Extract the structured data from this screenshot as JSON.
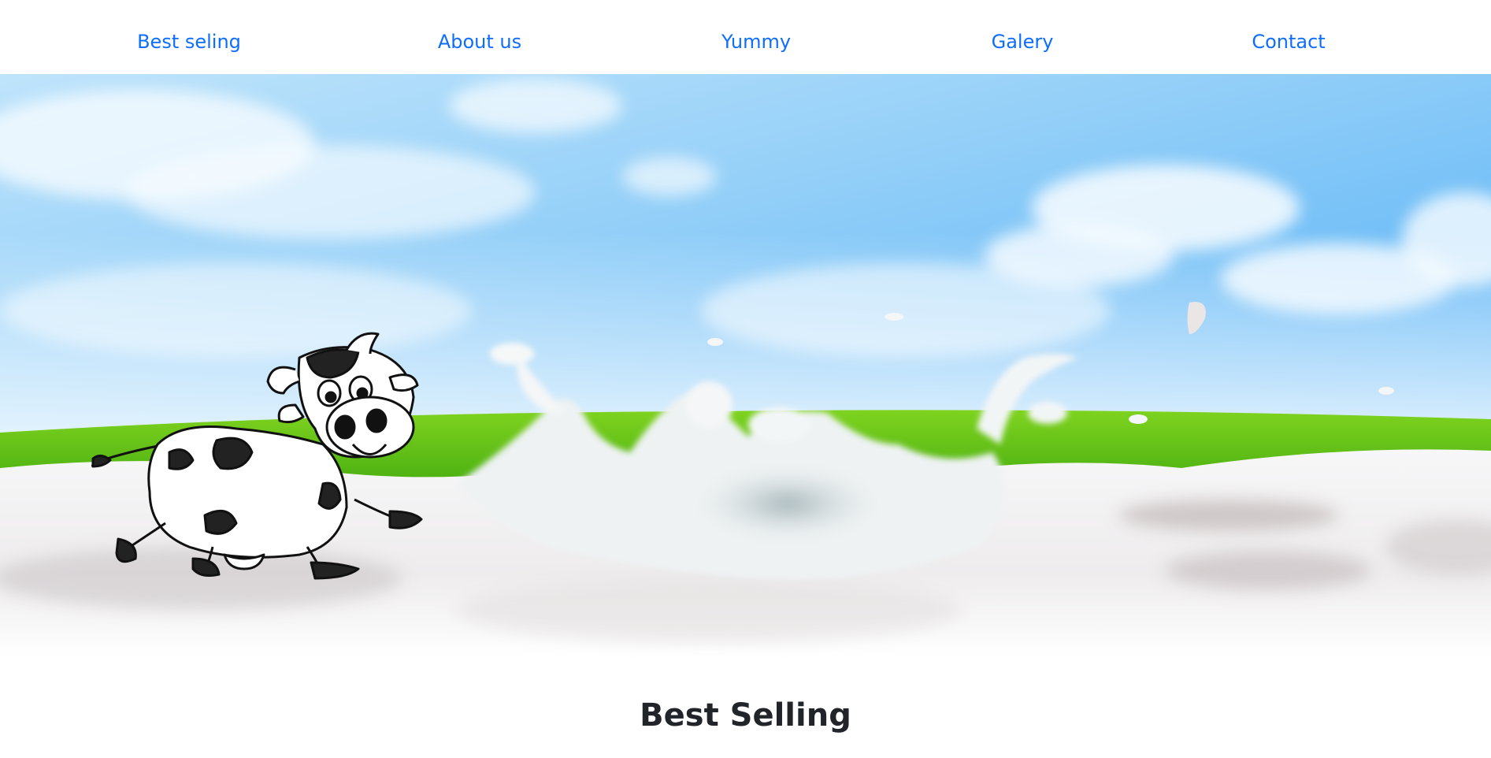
{
  "nav": {
    "items": [
      {
        "label": "Best seling"
      },
      {
        "label": "About us"
      },
      {
        "label": "Yummy"
      },
      {
        "label": "Galery"
      },
      {
        "label": "Contact"
      }
    ],
    "link_color": "#0d6efd"
  },
  "hero": {
    "image": "cartoon cow running through milk splash on green meadow under blue sky",
    "sky_color": "#5fb4f5",
    "grass_color": "#5cc219",
    "milk_color": "#f4f4f4"
  },
  "section": {
    "title": "Best Selling"
  }
}
